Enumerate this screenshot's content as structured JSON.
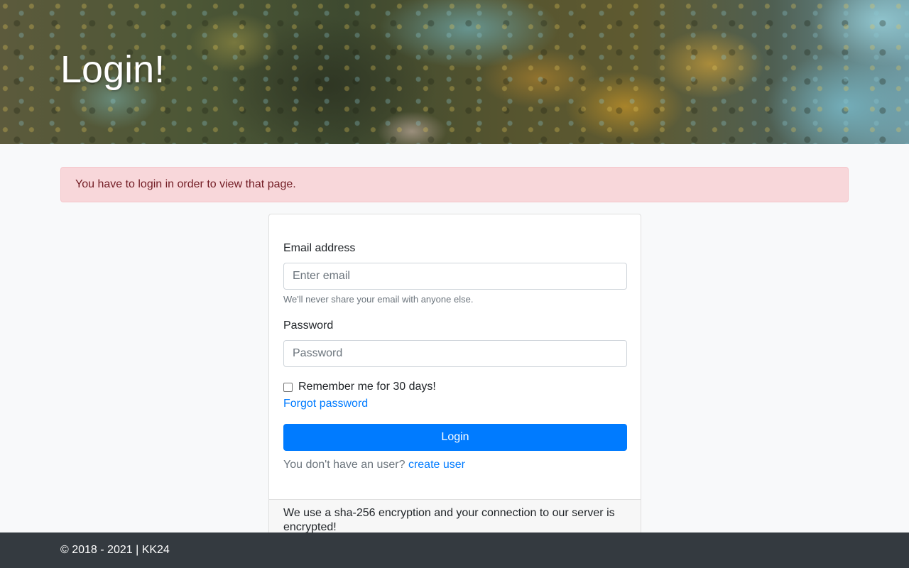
{
  "header": {
    "title": "Login!"
  },
  "alert": {
    "message": "You have to login in order to view that page."
  },
  "form": {
    "email_label": "Email address",
    "email_placeholder": "Enter email",
    "email_value": "",
    "email_help": "We'll never share your email with anyone else.",
    "password_label": "Password",
    "password_placeholder": "Password",
    "password_value": "",
    "remember_label": "Remember me for 30 days!",
    "remember_checked": false,
    "forgot_link": "Forgot password",
    "login_button": "Login",
    "signup_prompt": "You don't have an user?",
    "signup_link": "create user"
  },
  "card_footer": {
    "text": "We use a sha-256 encryption and your connection to our server is encrypted!"
  },
  "footer": {
    "copyright": "© 2018 - 2021 | KK24"
  },
  "colors": {
    "primary": "#007bff",
    "alert_bg": "#f8d7da",
    "alert_text": "#721c24",
    "footer_bg": "#343a40"
  }
}
